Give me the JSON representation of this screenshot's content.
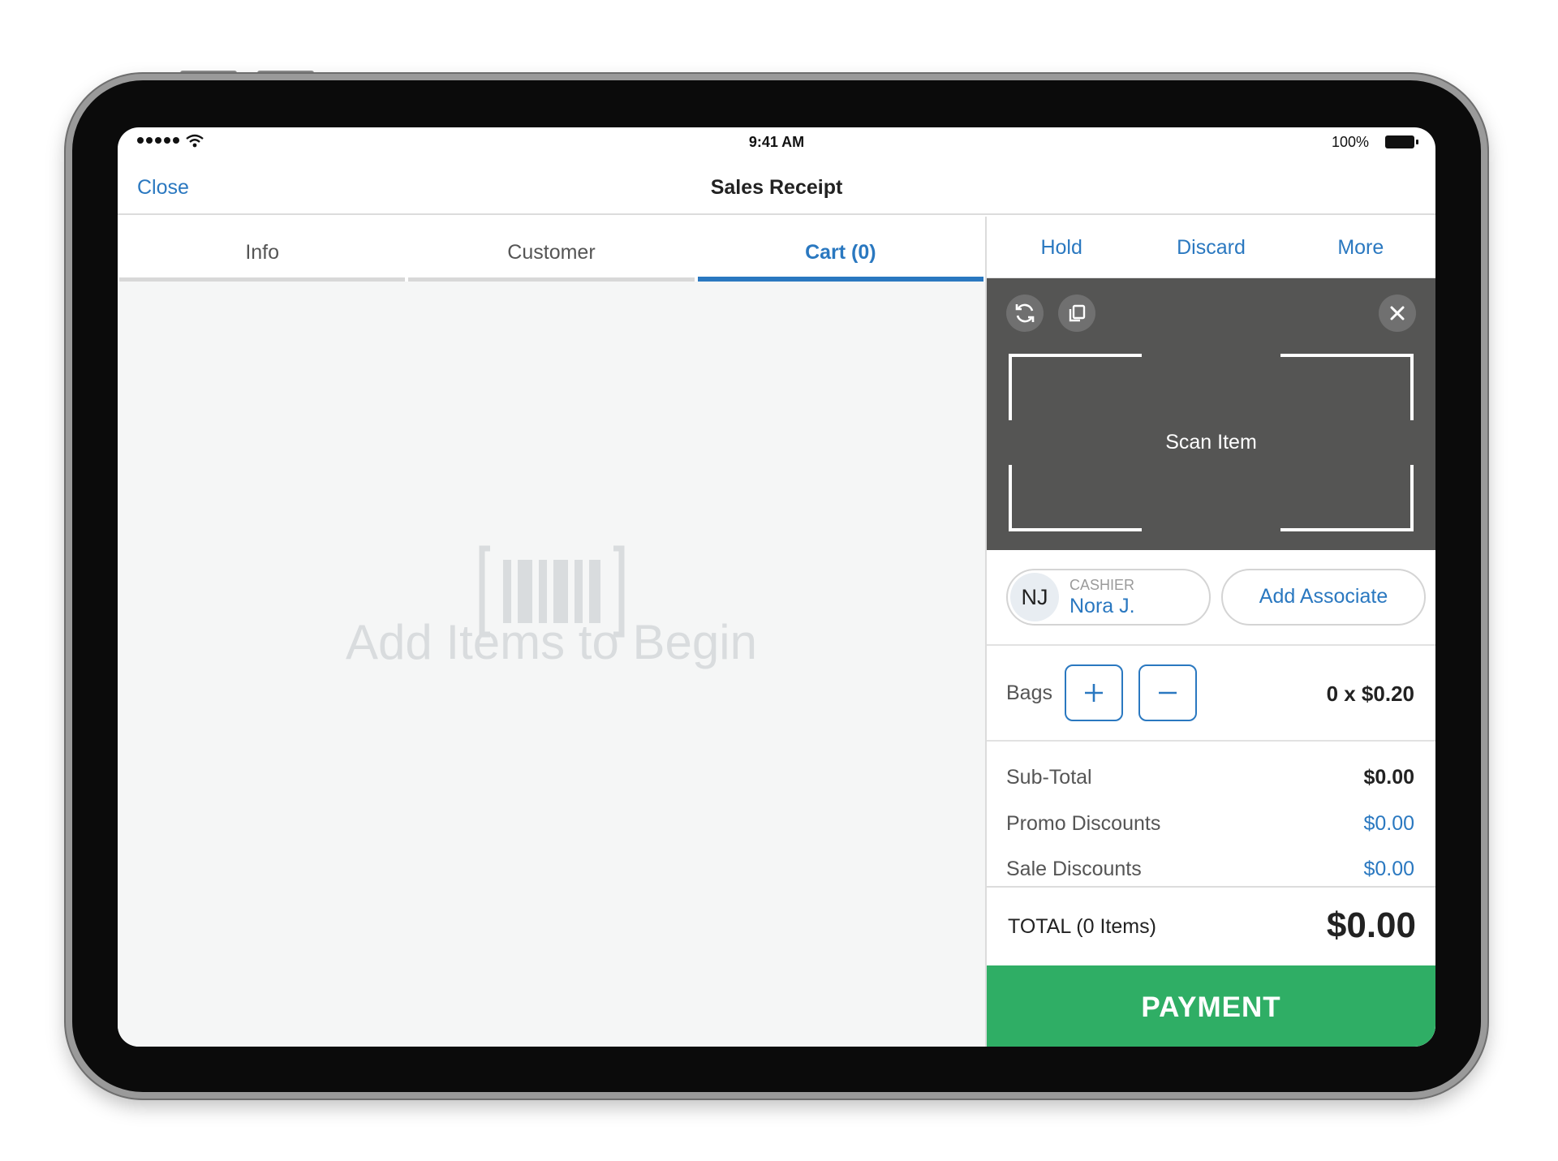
{
  "status_bar": {
    "time": "9:41 AM",
    "battery": "100%"
  },
  "nav": {
    "close_label": "Close",
    "title": "Sales Receipt"
  },
  "tabs": [
    {
      "label": "Info",
      "active": false
    },
    {
      "label": "Customer",
      "active": false
    },
    {
      "label": "Cart (0)",
      "active": true
    }
  ],
  "cart": {
    "empty_message": "Add Items to Begin",
    "empty_icon": "barcode-icon"
  },
  "actions": {
    "hold": "Hold",
    "discard": "Discard",
    "more": "More"
  },
  "scanner": {
    "label": "Scan Item",
    "icons": [
      "refresh-icon",
      "copy-icon",
      "close-icon"
    ]
  },
  "cashier": {
    "initials": "NJ",
    "caption": "CASHIER",
    "name": "Nora J."
  },
  "associate": {
    "label": "Add Associate"
  },
  "bags": {
    "label": "Bags",
    "value": "0 x $0.20"
  },
  "totals": {
    "subtotal_label": "Sub-Total",
    "subtotal": "$0.00",
    "promo_label": "Promo Discounts",
    "promo": "$0.00",
    "sale_label": "Sale Discounts",
    "sale": "$0.00"
  },
  "total": {
    "label": "TOTAL (0 Items)",
    "value": "$0.00"
  },
  "payment": {
    "label": "PAYMENT"
  },
  "colors": {
    "accent": "#2a78c0",
    "payment": "#2fae65",
    "scanner_bg": "#555554",
    "empty_text": "#d9dcde"
  }
}
